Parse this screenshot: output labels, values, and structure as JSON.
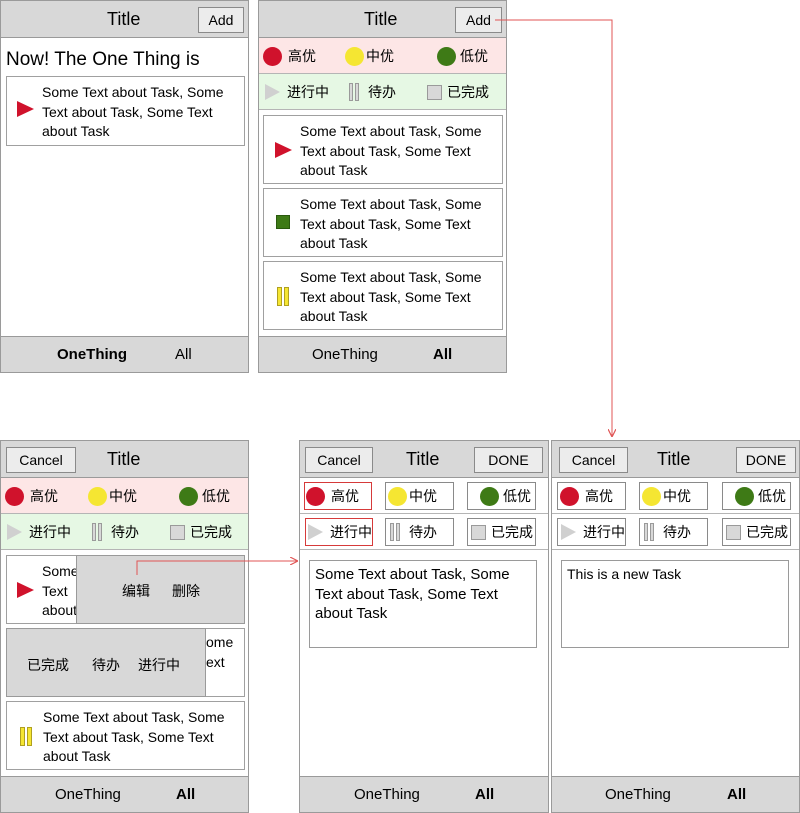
{
  "common": {
    "title": "Title",
    "add": "Add",
    "cancel": "Cancel",
    "done": "DONE",
    "tab_onething": "OneThing",
    "tab_all": "All",
    "task_text": "Some Text about Task, Some Text about Task, Some Text about Task"
  },
  "priority": {
    "high": "高优",
    "mid": "中优",
    "low": "低优"
  },
  "status": {
    "doing": "进行中",
    "todo": "待办",
    "done": "已完成"
  },
  "screen1": {
    "heading": "Now! The One Thing is"
  },
  "screen3": {
    "edit": "编辑",
    "delete": "删除",
    "peek1_lines": [
      "Some",
      "Text",
      "about"
    ],
    "peek2_lines": [
      "ome",
      "ext"
    ]
  },
  "screen5": {
    "new_task": "This is a new Task"
  },
  "colors": {
    "high": "#d0122c",
    "mid": "#f5e632",
    "low": "#3e7a16",
    "arrow": "#e05555"
  }
}
